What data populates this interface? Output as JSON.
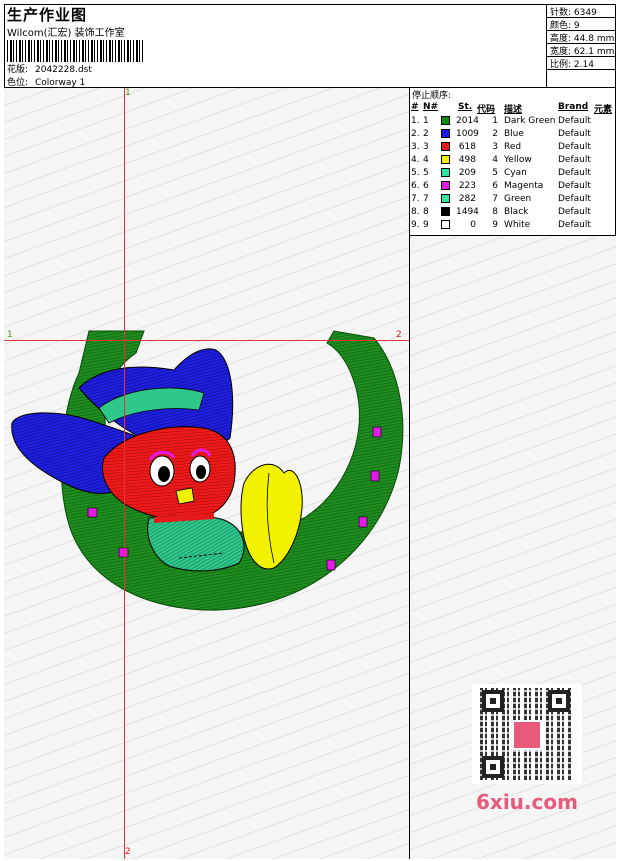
{
  "header": {
    "title": "生产作业图",
    "company": "Wilcom(汇宏) 装饰工作室",
    "design_label": "花版:",
    "design_value": "2042228.dst",
    "colorway_label": "色位:",
    "colorway_value": "Colorway 1"
  },
  "stats": [
    {
      "label": "针数:",
      "value": "6349"
    },
    {
      "label": "颜色:",
      "value": "9"
    },
    {
      "label": "高度:",
      "value": "44.8 mm"
    },
    {
      "label": "宽度:",
      "value": "62.1 mm"
    },
    {
      "label": "比例:",
      "value": "2.14"
    }
  ],
  "markers": {
    "top": "1",
    "left": "1",
    "right": "2",
    "bottom": "2"
  },
  "color_table": {
    "title": "停止顺序:",
    "headers": {
      "hash": "#",
      "no": "N#",
      "st": "St.",
      "code": "代码",
      "desc": "描述",
      "brand": "Brand",
      "elem": "元素"
    },
    "rows": [
      {
        "n": "1.",
        "no": "1",
        "color": "#0a8a0a",
        "st": "2014",
        "code": "1",
        "desc": "Dark Green",
        "brand": "Default"
      },
      {
        "n": "2.",
        "no": "2",
        "color": "#1a1ae6",
        "st": "1009",
        "code": "2",
        "desc": "Blue",
        "brand": "Default"
      },
      {
        "n": "3.",
        "no": "3",
        "color": "#e61a1a",
        "st": "618",
        "code": "3",
        "desc": "Red",
        "brand": "Default"
      },
      {
        "n": "4.",
        "no": "4",
        "color": "#f2f200",
        "st": "498",
        "code": "4",
        "desc": "Yellow",
        "brand": "Default"
      },
      {
        "n": "5.",
        "no": "5",
        "color": "#2ee6a0",
        "st": "209",
        "code": "5",
        "desc": "Cyan",
        "brand": "Default"
      },
      {
        "n": "6.",
        "no": "6",
        "color": "#e61ae6",
        "st": "223",
        "code": "6",
        "desc": "Magenta",
        "brand": "Default"
      },
      {
        "n": "7.",
        "no": "7",
        "color": "#33e6a0",
        "st": "282",
        "code": "7",
        "desc": "Green",
        "brand": "Default"
      },
      {
        "n": "8.",
        "no": "8",
        "color": "#000000",
        "st": "1494",
        "code": "8",
        "desc": "Black",
        "brand": "Default"
      },
      {
        "n": "9.",
        "no": "9",
        "color": "#ffffff",
        "st": "0",
        "code": "9",
        "desc": "White",
        "brand": "Default"
      }
    ]
  },
  "watermark": "6xiu.com"
}
